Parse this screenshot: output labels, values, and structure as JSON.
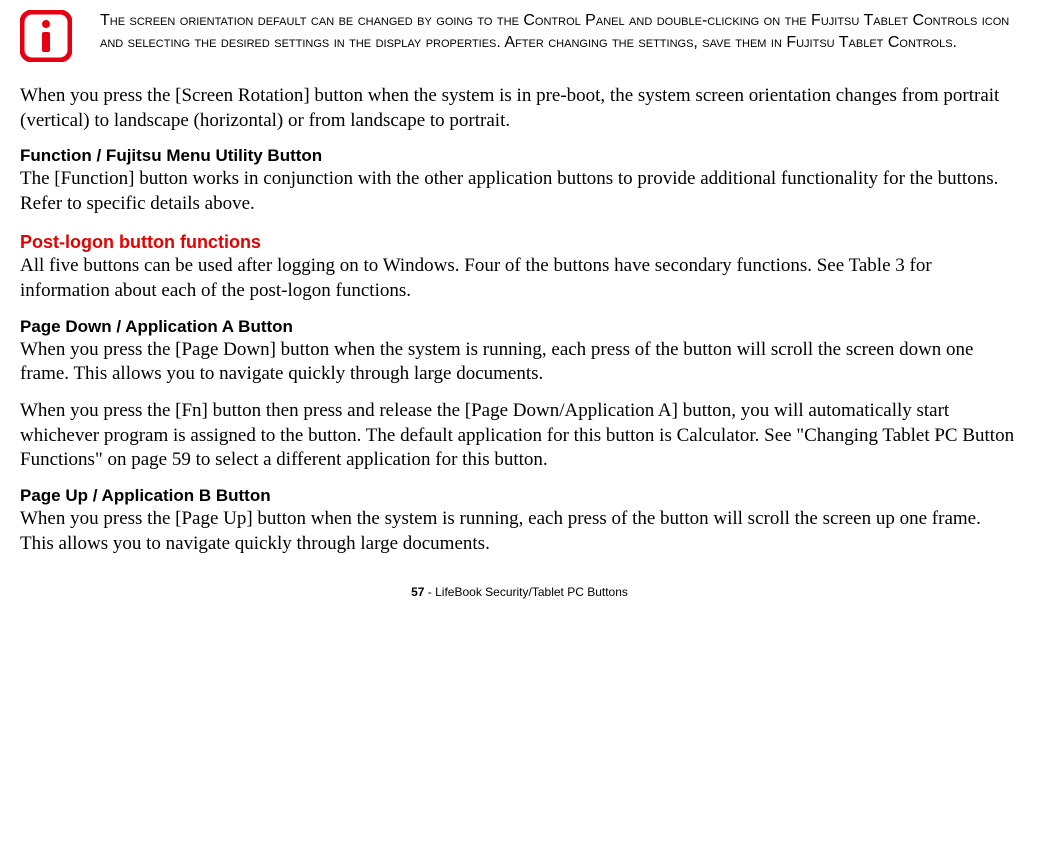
{
  "note": {
    "text": "The screen orientation default can be changed by going to the Control Panel and double-clicking on the Fujitsu Tablet Controls icon and selecting the desired settings in the display properties. After changing the settings, save them in Fujitsu Tablet Controls."
  },
  "paragraphs": {
    "p1": "When you press the [Screen Rotation] button when the system is in pre-boot, the system screen orientation changes from portrait (vertical) to landscape (horizontal) or from landscape to portrait.",
    "h_function": "Function / Fujitsu Menu Utility Button",
    "p2": "The [Function] button works in conjunction with the other application buttons to provide additional functionality for the buttons. Refer to specific details above.",
    "h_postlogon": "Post-logon button functions",
    "p3": "All five buttons can be used after logging on to Windows. Four of the buttons have secondary functions. See Table 3 for information about each of the post-logon functions.",
    "h_pagedownA": "Page Down / Application A Button",
    "p4": "When you press the [Page Down] button when the system is running, each press of the button will scroll the screen down one frame. This allows you to navigate quickly through large documents.",
    "p5": "When you press the [Fn] button then press and release the [Page Down/Application A] button, you will automatically start whichever program is assigned to the button. The default application for this button is Calculator. See \"Changing Tablet PC Button Functions\" on page 59 to select a different application for this button.",
    "h_pageupB": "Page Up / Application B Button",
    "p6": "When you press the [Page Up] button when the system is running, each press of the button will scroll the screen up one frame. This allows you to navigate quickly through large documents."
  },
  "footer": {
    "page_number": "57",
    "separator": " - ",
    "title": "LifeBook Security/Tablet PC Buttons"
  }
}
